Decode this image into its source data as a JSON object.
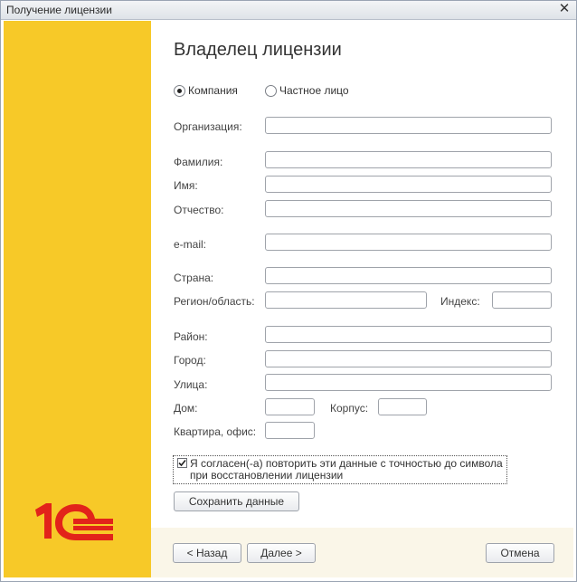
{
  "window": {
    "title": "Получение лицензии",
    "close_symbol": "✕"
  },
  "heading": "Владелец лицензии",
  "owner_type": {
    "options": [
      "Компания",
      "Частное лицо"
    ],
    "selected": "Компания"
  },
  "form": {
    "organization": {
      "label": "Организация:",
      "value": ""
    },
    "last_name": {
      "label": "Фамилия:",
      "value": ""
    },
    "first_name": {
      "label": "Имя:",
      "value": ""
    },
    "middle_name": {
      "label": "Отчество:",
      "value": ""
    },
    "email": {
      "label": "e-mail:",
      "value": ""
    },
    "country": {
      "label": "Страна:",
      "value": ""
    },
    "region": {
      "label": "Регион/область:",
      "value": ""
    },
    "postcode": {
      "label": "Индекс:",
      "value": ""
    },
    "district": {
      "label": "Район:",
      "value": ""
    },
    "city": {
      "label": "Город:",
      "value": ""
    },
    "street": {
      "label": "Улица:",
      "value": ""
    },
    "house": {
      "label": "Дом:",
      "value": ""
    },
    "building": {
      "label": "Корпус:",
      "value": ""
    },
    "apartment": {
      "label": "Квартира, офис:",
      "value": ""
    }
  },
  "agreement": {
    "checked": true,
    "text": "Я согласен(-а) повторить эти данные с точностью до символа при восстановлении лицензии"
  },
  "buttons": {
    "save": "Сохранить данные",
    "back": "< Назад",
    "next": "Далее >",
    "cancel": "Отмена"
  },
  "brand": {
    "logo_text": "1С",
    "accent_color": "#e2231a",
    "panel_color": "#f7c928"
  }
}
